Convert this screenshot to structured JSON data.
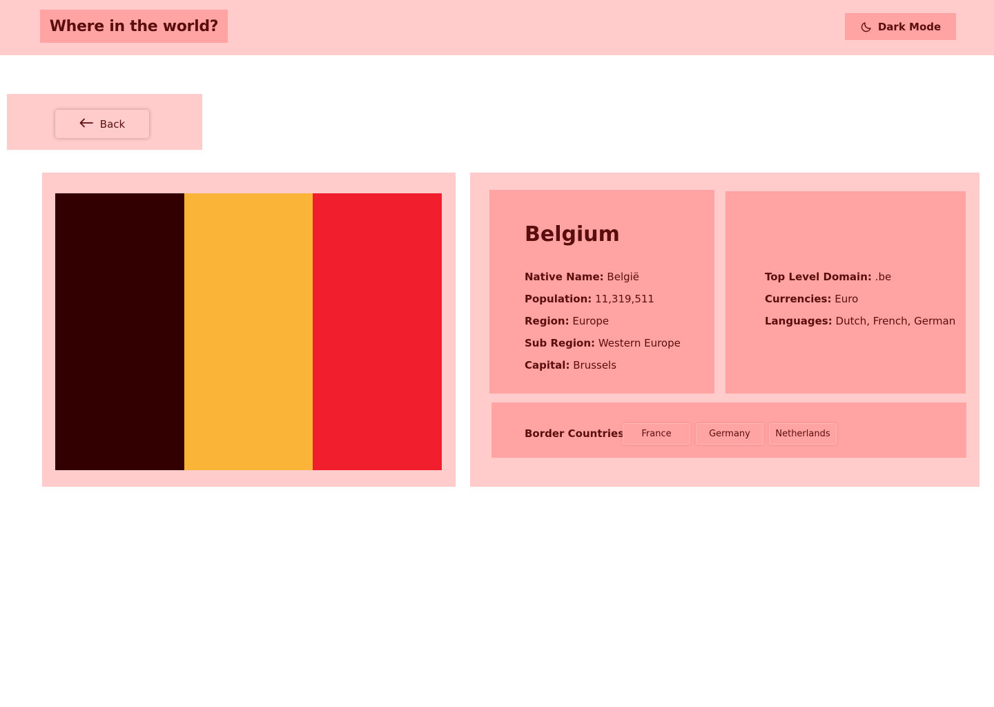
{
  "header": {
    "title": "Where in the world?",
    "dark_mode_label": "Dark Mode",
    "dark_mode_icon": "moon-icon"
  },
  "back": {
    "label": "Back",
    "icon": "arrow-left-icon"
  },
  "country": {
    "name": "Belgium",
    "flag_colors": [
      "#330000",
      "#fab437",
      "#f11f2e"
    ],
    "facts_left": [
      {
        "label": "Native Name:",
        "value": "België"
      },
      {
        "label": "Population:",
        "value": "11,319,511"
      },
      {
        "label": "Region:",
        "value": "Europe"
      },
      {
        "label": "Sub Region:",
        "value": "Western Europe"
      },
      {
        "label": "Capital:",
        "value": "Brussels"
      }
    ],
    "facts_right": [
      {
        "label": "Top Level Domain:",
        "value": ".be"
      },
      {
        "label": "Currencies:",
        "value": "Euro"
      },
      {
        "label": "Languages:",
        "value": "Dutch, French, German"
      }
    ],
    "border_label": "Border Countries:",
    "borders": [
      "France",
      "Germany",
      "Netherlands"
    ]
  },
  "colors": {
    "header_bg": "#ffcbcb",
    "accent_bg": "#ffa3a3",
    "text": "#5a0d0d"
  }
}
